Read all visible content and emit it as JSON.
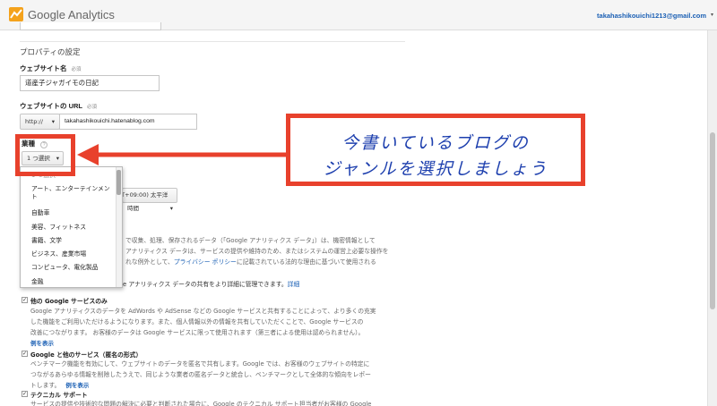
{
  "header": {
    "logo_text": "Google Analytics",
    "user_email": "takahashikouichi1213@gmail.com"
  },
  "property": {
    "section_title": "プロパティの設定",
    "website_name_label": "ウェブサイト名",
    "website_name_required": "必須",
    "website_name_value": "道産子ジャガイモの日記",
    "website_url_label": "ウェブサイトの URL",
    "website_url_required": "必須",
    "protocol_value": "http://",
    "url_value": "takahashikouichi.hatenablog.com",
    "industry_label": "業種",
    "industry_help": "?",
    "industry_button": "1 つ選択",
    "timezone_value": "(GMT+09:00) 太平洋時間"
  },
  "dropdown": {
    "items": [
      "1 つ選択",
      "アート、エンターテインメント",
      "自動車",
      "美容、フィットネス",
      "書籍、文学",
      "ビジネス、産業市場",
      "コンピュータ、電化製品",
      "金融"
    ]
  },
  "data_sharing": {
    "line1": "で収集、処理、保存されるデータ（「Google アナリティクス データ」）は、機密情報として",
    "line2": "アナリティクス データは、サービスの提供や維持のため、またはシステムの運営上必要な操作を",
    "line3_a": "れな例外として、",
    "line3_link": "プライバシー ポリシー",
    "line3_b": "に記載されている法的な理由に基づいて使用される",
    "manage_text": "e アナリティクス データの共有をより詳細に管理できます。",
    "manage_link": "詳細"
  },
  "options": [
    {
      "label": "他の Google サービスのみ",
      "lines": [
        "Google アナリティクスのデータを AdWords や AdSense などの Google サービスと共有することによって、より多くの充実",
        "した機能をご利用いただけるようになります。また、個人情報以外の情報を共有していただくことで、Google サービスの",
        "改善につながります。 お客様のデータは Google サービスに限って使用されます（第三者による使用は認められません）。"
      ],
      "example": "例を表示",
      "checked": "✓"
    },
    {
      "label": "Google と他のサービス（匿名の形式）",
      "lines": [
        "ベンチマーク機能を有効にして、ウェブサイトのデータを匿名で共有します。Google では、お客様のウェブサイトの特定に",
        "つながるあらゆる情報を削除したうえで、同じような業者の匿名データと統合し、ベンチマークとして全体的な傾向をレポー",
        "トします。"
      ],
      "example": "例を表示",
      "checked": "✓"
    },
    {
      "label": "テクニカル サポート",
      "lines": [
        "サービスの提供や技術的な問題の解決に必要と判断された場合に、Google のテクニカル サポート担当者がお客様の Google"
      ],
      "example": "",
      "checked": "✓"
    }
  ],
  "annotation": {
    "line1": "今書いているブログの",
    "line2": "ジャンルを選択しましょう",
    "color": "#e8412c",
    "text_color": "#1d3fae"
  }
}
